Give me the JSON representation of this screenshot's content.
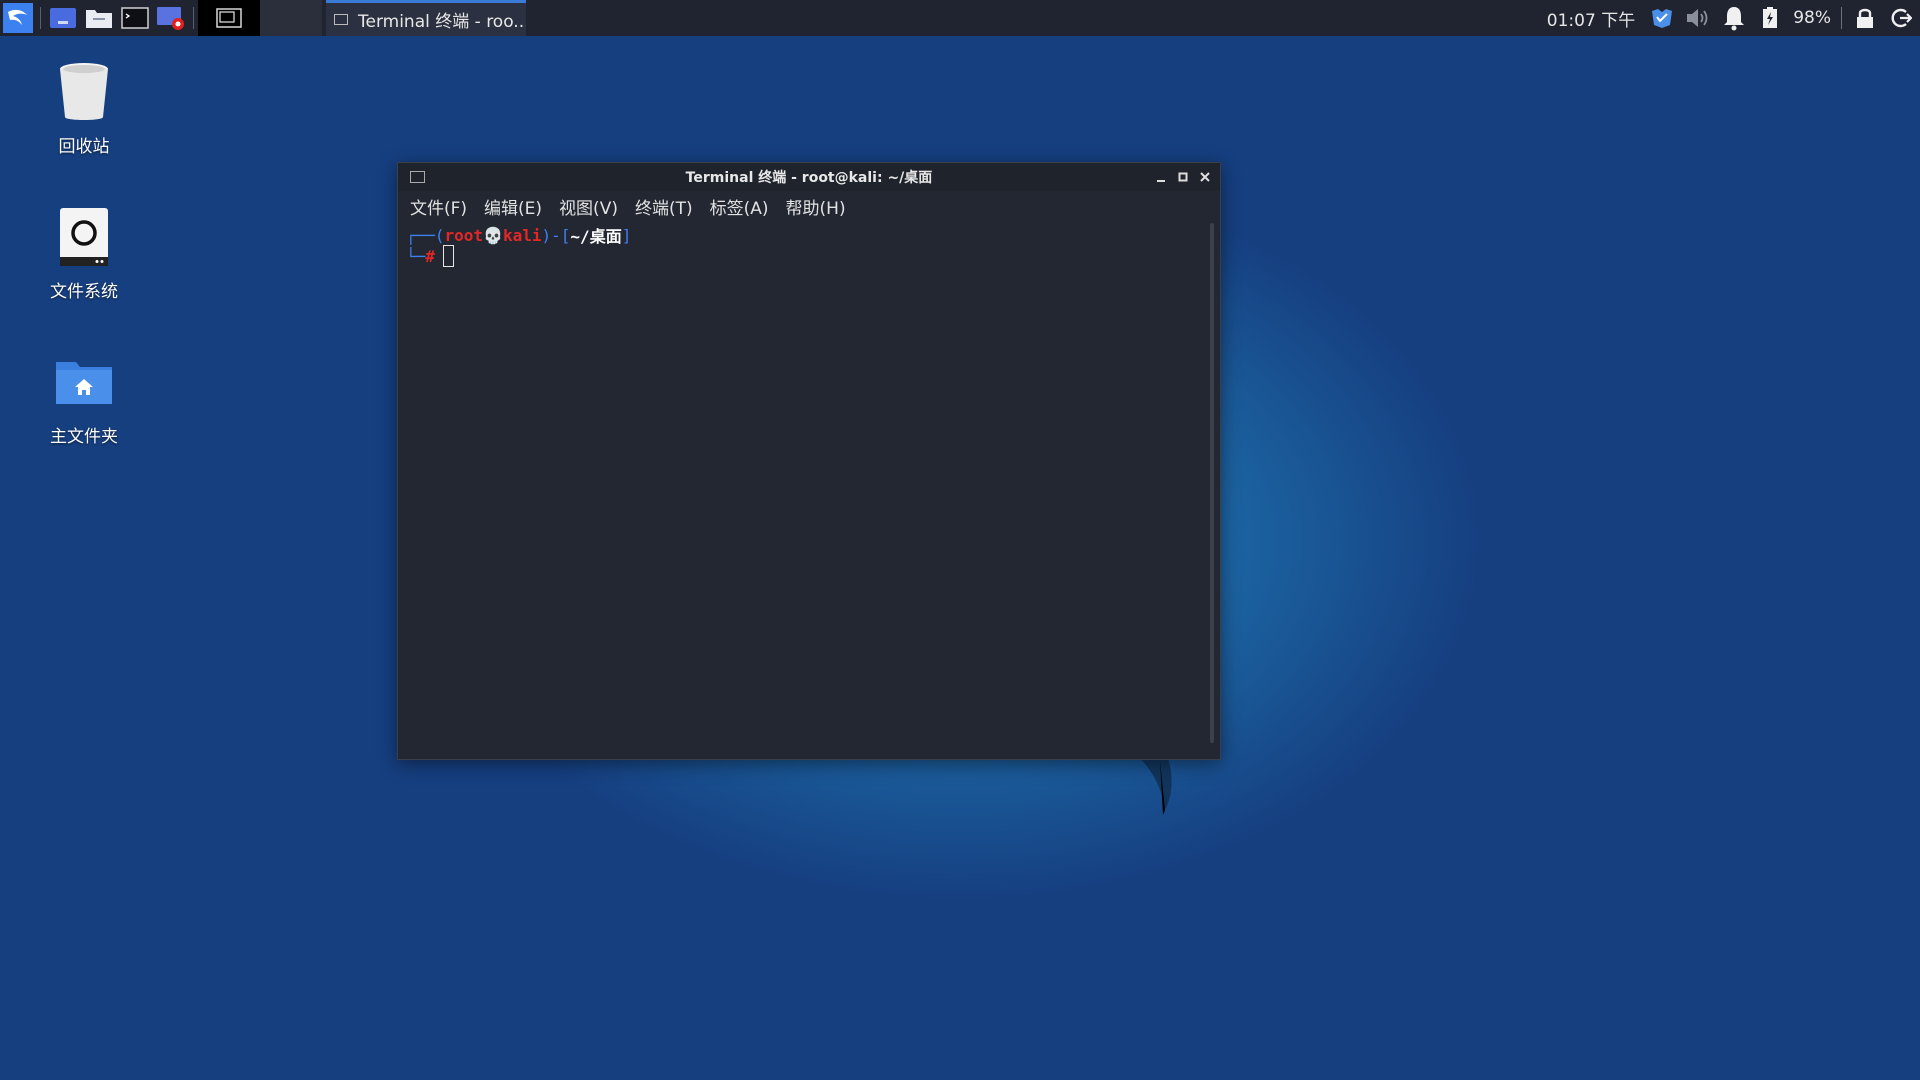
{
  "panel": {
    "taskbar_label": "Terminal 终端 - roo...",
    "clock": "01:07 下午",
    "battery": "98%",
    "icons": [
      "kali-menu-icon",
      "workspace-icon",
      "file-manager-icon",
      "terminal-icon",
      "screen-recorder-icon",
      "window-switch-icon",
      "network-icon",
      "volume-icon",
      "notification-bell-icon",
      "battery-icon",
      "lock-icon",
      "logout-icon"
    ]
  },
  "desktop": {
    "trash_label": "回收站",
    "filesystem_label": "文件系统",
    "home_label": "主文件夹"
  },
  "window": {
    "title": "Terminal 终端 - root@kali: ~/桌面",
    "menu": {
      "file": "文件(F)",
      "edit": "编辑(E)",
      "view": "视图(V)",
      "terminal": "终端(T)",
      "tabs": "标签(A)",
      "help": "帮助(H)"
    },
    "prompt": {
      "open_bracket": "┌──(",
      "user": "root",
      "skull": "💀",
      "host": "kali",
      "mid": ")-[",
      "path": "~/桌面",
      "close_bracket": "]",
      "line2_prefix": "└─",
      "hash": "#"
    }
  },
  "colors": {
    "panel_bg": "#1f2430",
    "terminal_bg": "#232731",
    "prompt_blue": "#3d80f0",
    "prompt_red": "#e32626",
    "desktop_blue": "#1f6fab"
  }
}
